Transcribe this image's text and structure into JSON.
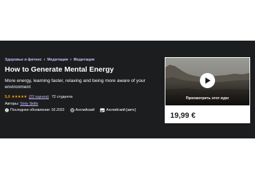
{
  "breadcrumb": {
    "items": [
      "Здоровье и фитнес",
      "Медитация",
      "Медитация"
    ]
  },
  "course": {
    "title": "How to Generate Mental Energy",
    "subtitle": "More energy, learning faster, relaxing and being more aware of your environment",
    "rating": "5,0",
    "stars": "★★★★★",
    "reviews": "(22 оценок)",
    "students": "72 студента",
    "authors_label": "Авторы:",
    "author": "Sixty Skills",
    "last_updated": "Последнее обновление: 02.2022",
    "language": "Английский",
    "captions": "Английский [авто]"
  },
  "card": {
    "preview_label": "Просмотреть этот курс",
    "price": "19,99 €"
  },
  "colors": {
    "hero_bg": "#1c1d1f",
    "rating": "#f69c08",
    "link": "#cec0fc"
  },
  "icons": [
    "alert-icon",
    "globe-icon",
    "captions-icon",
    "play-icon",
    "chevron-right-icon"
  ]
}
